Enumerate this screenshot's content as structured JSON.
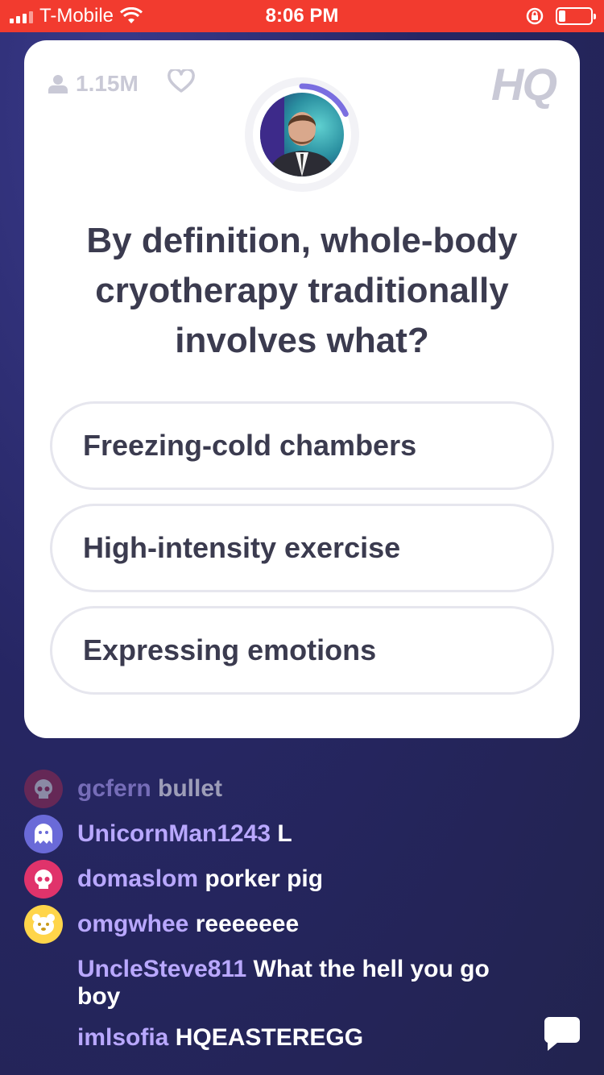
{
  "status_bar": {
    "carrier": "T-Mobile",
    "time": "8:06 PM",
    "battery_level": 0.2
  },
  "header": {
    "viewer_count": "1.15M",
    "logo": "HQ"
  },
  "host": {
    "timer_progress": 0.18
  },
  "question": {
    "text": "By definition, whole-body cryotherapy traditionally involves what?"
  },
  "answers": [
    {
      "label": "Freezing-cold chambers"
    },
    {
      "label": "High-intensity exercise"
    },
    {
      "label": "Expressing emotions"
    }
  ],
  "chat": [
    {
      "user": "gcfern",
      "message": "bullet",
      "avatar": "skull-icon",
      "avatar_color": "#9a2a4e"
    },
    {
      "user": "UnicornMan1243",
      "message": "L",
      "avatar": "ghost-icon",
      "avatar_color": "#6a6ad8"
    },
    {
      "user": "domaslom",
      "message": "porker pig",
      "avatar": "skull-icon",
      "avatar_color": "#e0336b"
    },
    {
      "user": "omgwhee",
      "message": "reeeeeee",
      "avatar": "bear-icon",
      "avatar_color": "#ffd54a"
    },
    {
      "user": "UncleSteve811",
      "message": "What the hell you go boy",
      "avatar": "",
      "avatar_color": ""
    },
    {
      "user": "imlsofia",
      "message": "HQEASTEREGG",
      "avatar": "",
      "avatar_color": ""
    }
  ],
  "colors": {
    "status_bar": "#f23b2f",
    "background": "#262663",
    "username": "#b9a8ff",
    "timer_ring": "#7a6ee0"
  }
}
